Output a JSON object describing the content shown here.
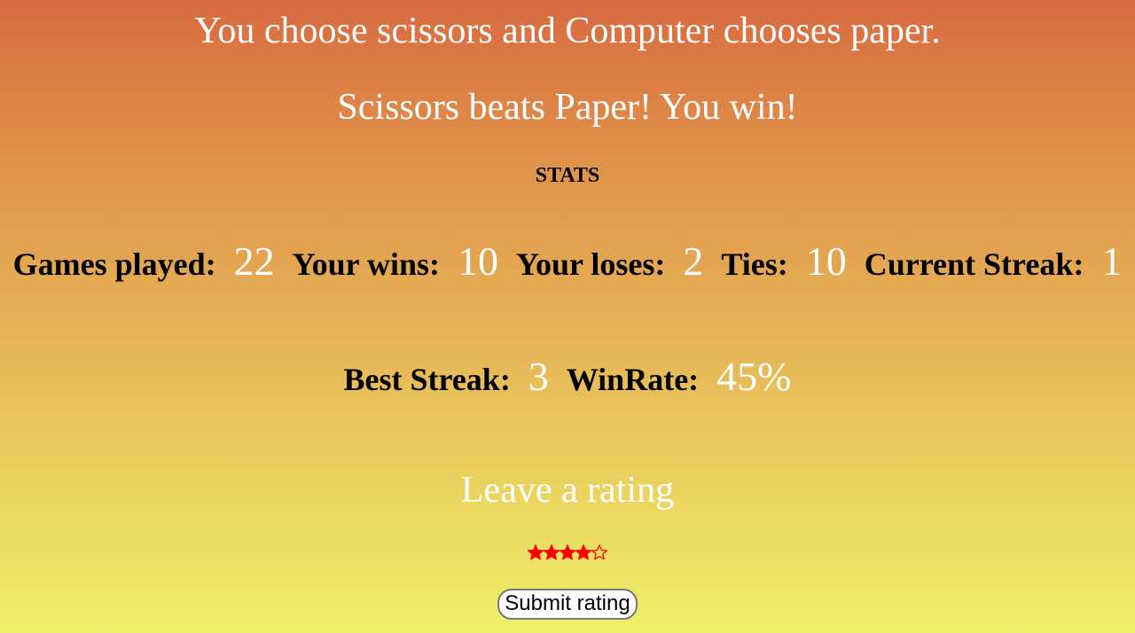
{
  "messages": {
    "choice": "You choose scissors and Computer chooses paper.",
    "result": "Scissors beats Paper! You win!"
  },
  "stats": {
    "heading": "STATS",
    "games_played": {
      "label": "Games played:",
      "value": "22"
    },
    "wins": {
      "label": "Your wins:",
      "value": "10"
    },
    "loses": {
      "label": "Your loses:",
      "value": "2"
    },
    "ties": {
      "label": "Ties:",
      "value": "10"
    },
    "current_streak": {
      "label": "Current Streak:",
      "value": "1"
    },
    "best_streak": {
      "label": "Best Streak:",
      "value": "3"
    },
    "win_rate": {
      "label": "WinRate:",
      "value": "45%"
    }
  },
  "rating": {
    "title": "Leave a rating",
    "stars_selected": 4,
    "stars_total": 5,
    "star_color": "#ff0000",
    "submit_label": "Submit rating"
  }
}
